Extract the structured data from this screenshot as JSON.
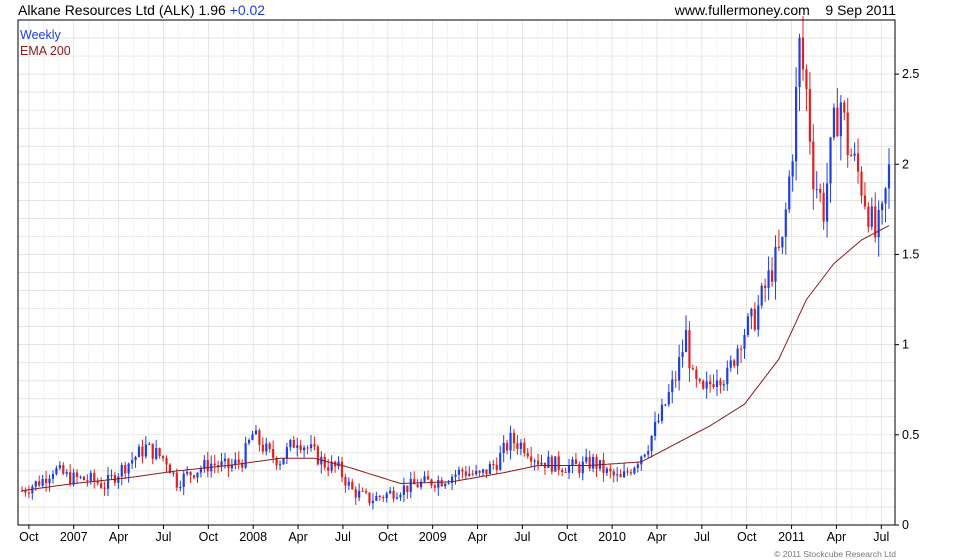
{
  "header": {
    "title": "Alkane Resources Ltd (ALK)",
    "price": "1.96",
    "change": "+0.02",
    "website": "www.fullermoney.com",
    "date": "9 Sep 2011"
  },
  "legend": {
    "weekly": "Weekly",
    "ema": "EMA 200"
  },
  "footer": {
    "copyright": "© 2011 Stockcube Research Ltd"
  },
  "colors": {
    "up": "#1f3fe0",
    "down": "#e02020",
    "ema": "#8b1a1a",
    "grid": "#dcdcdc"
  },
  "chart_data": {
    "type": "candlestick",
    "interval": "weekly",
    "x_tick_labels": [
      "Oct",
      "2007",
      "Apr",
      "Jul",
      "Oct",
      "2008",
      "Apr",
      "Jul",
      "Oct",
      "2009",
      "Apr",
      "Jul",
      "Oct",
      "2010",
      "Apr",
      "Jul",
      "Oct",
      "2011",
      "Apr",
      "Jul"
    ],
    "y_tick_labels": [
      "0",
      "0.5",
      "1",
      "1.5",
      "2",
      "2.5"
    ],
    "y_ticks": [
      0,
      0.5,
      1,
      1.5,
      2,
      2.5
    ],
    "ylim": [
      0,
      2.8
    ],
    "y_axis_position": "right",
    "grid": true,
    "legend_position": "top-left",
    "price_path": [
      [
        0,
        0.19
      ],
      [
        6,
        0.25
      ],
      [
        9,
        0.31
      ],
      [
        14,
        0.26
      ],
      [
        20,
        0.25
      ],
      [
        24,
        0.22
      ],
      [
        30,
        0.33
      ],
      [
        36,
        0.43
      ],
      [
        42,
        0.36
      ],
      [
        45,
        0.24
      ],
      [
        50,
        0.3
      ],
      [
        55,
        0.34
      ],
      [
        60,
        0.32
      ],
      [
        64,
        0.36
      ],
      [
        67,
        0.5
      ],
      [
        72,
        0.39
      ],
      [
        75,
        0.36
      ],
      [
        80,
        0.48
      ],
      [
        84,
        0.41
      ],
      [
        88,
        0.34
      ],
      [
        92,
        0.31
      ],
      [
        96,
        0.19
      ],
      [
        101,
        0.14
      ],
      [
        106,
        0.17
      ],
      [
        110,
        0.2
      ],
      [
        116,
        0.23
      ],
      [
        122,
        0.25
      ],
      [
        128,
        0.3
      ],
      [
        133,
        0.27
      ],
      [
        138,
        0.35
      ],
      [
        142,
        0.47
      ],
      [
        146,
        0.44
      ],
      [
        150,
        0.36
      ],
      [
        156,
        0.33
      ],
      [
        162,
        0.32
      ],
      [
        166,
        0.35
      ],
      [
        170,
        0.29
      ],
      [
        174,
        0.25
      ],
      [
        178,
        0.34
      ],
      [
        182,
        0.45
      ],
      [
        186,
        0.62
      ],
      [
        190,
        0.82
      ],
      [
        193,
        1.05
      ],
      [
        195,
        0.8
      ],
      [
        198,
        0.72
      ],
      [
        202,
        0.85
      ],
      [
        205,
        0.82
      ],
      [
        209,
        1.05
      ],
      [
        213,
        1.15
      ],
      [
        218,
        1.42
      ],
      [
        221,
        1.55
      ],
      [
        224,
        2.1
      ],
      [
        226,
        2.65
      ],
      [
        228,
        2.4
      ],
      [
        230,
        1.95
      ],
      [
        233,
        1.75
      ],
      [
        236,
        2.2
      ],
      [
        238,
        2.35
      ],
      [
        240,
        2.1
      ],
      [
        243,
        1.95
      ],
      [
        246,
        1.75
      ],
      [
        248,
        1.6
      ],
      [
        250,
        1.7
      ],
      [
        252,
        1.96
      ]
    ],
    "ema_path": [
      [
        0,
        0.19
      ],
      [
        15,
        0.23
      ],
      [
        30,
        0.26
      ],
      [
        45,
        0.3
      ],
      [
        60,
        0.33
      ],
      [
        75,
        0.37
      ],
      [
        85,
        0.37
      ],
      [
        95,
        0.32
      ],
      [
        110,
        0.23
      ],
      [
        125,
        0.24
      ],
      [
        140,
        0.29
      ],
      [
        150,
        0.33
      ],
      [
        165,
        0.33
      ],
      [
        180,
        0.35
      ],
      [
        190,
        0.45
      ],
      [
        200,
        0.55
      ],
      [
        210,
        0.67
      ],
      [
        220,
        0.92
      ],
      [
        228,
        1.25
      ],
      [
        236,
        1.45
      ],
      [
        244,
        1.58
      ],
      [
        252,
        1.66
      ]
    ]
  }
}
